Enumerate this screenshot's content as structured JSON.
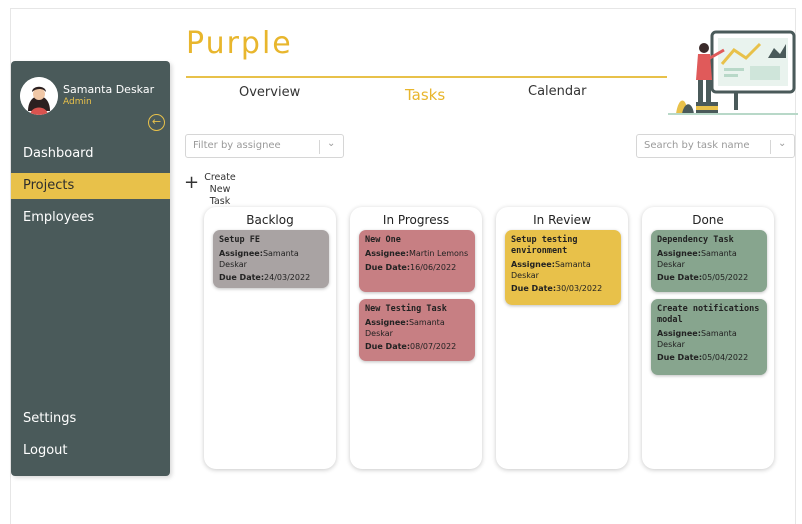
{
  "sidebar": {
    "profile_name": "Samanta Deskar",
    "profile_role": "Admin",
    "collapse_icon": "arrow-left-circle-icon",
    "nav": [
      {
        "label": "Dashboard"
      },
      {
        "label": "Projects",
        "active": true
      },
      {
        "label": "Employees"
      }
    ],
    "bottom_nav": [
      {
        "label": "Settings"
      },
      {
        "label": "Logout"
      }
    ]
  },
  "header": {
    "brand": "Purple",
    "tabs": [
      {
        "label": "Overview"
      },
      {
        "label": "Tasks",
        "active": true
      },
      {
        "label": "Calendar"
      }
    ]
  },
  "filters": {
    "assignee_placeholder": "Filter by assignee",
    "search_placeholder": "Search by task name"
  },
  "create_task_label": "Create New Task",
  "board": {
    "columns": [
      {
        "title": "Backlog",
        "cards": [
          {
            "title": "Setup FE",
            "assignee_label": "Assignee:",
            "assignee": "Samanta Deskar",
            "due_label": "Due Date:",
            "due": "24/03/2022",
            "color": "#a9a3a3"
          }
        ]
      },
      {
        "title": "In Progress",
        "cards": [
          {
            "title": "New One",
            "assignee_label": "Assignee:",
            "assignee": "Martin Lemons",
            "due_label": "Due Date:",
            "due": "16/06/2022",
            "color": "#c77f83"
          },
          {
            "title": "New Testing Task",
            "assignee_label": "Assignee:",
            "assignee": "Samanta Deskar",
            "due_label": "Due Date:",
            "due": "08/07/2022",
            "color": "#c77f83"
          }
        ]
      },
      {
        "title": "In Review",
        "cards": [
          {
            "title": "Setup testing environment",
            "assignee_label": "Assignee:",
            "assignee": "Samanta Deskar",
            "due_label": "Due Date:",
            "due": "30/03/2022",
            "color": "#e8c14a"
          }
        ]
      },
      {
        "title": "Done",
        "cards": [
          {
            "title": "Dependency Task",
            "assignee_label": "Assignee:",
            "assignee": "Samanta Deskar",
            "due_label": "Due Date:",
            "due": "05/05/2022",
            "color": "#87a58e"
          },
          {
            "title": "Create notifications modal",
            "assignee_label": "Assignee:",
            "assignee": "Samanta Deskar",
            "due_label": "Due Date:",
            "due": "05/04/2022",
            "color": "#87a58e"
          }
        ]
      }
    ]
  },
  "colors": {
    "accent": "#e8c14a",
    "sidebar": "#4a5a5a",
    "brand": "#e8b62d"
  }
}
